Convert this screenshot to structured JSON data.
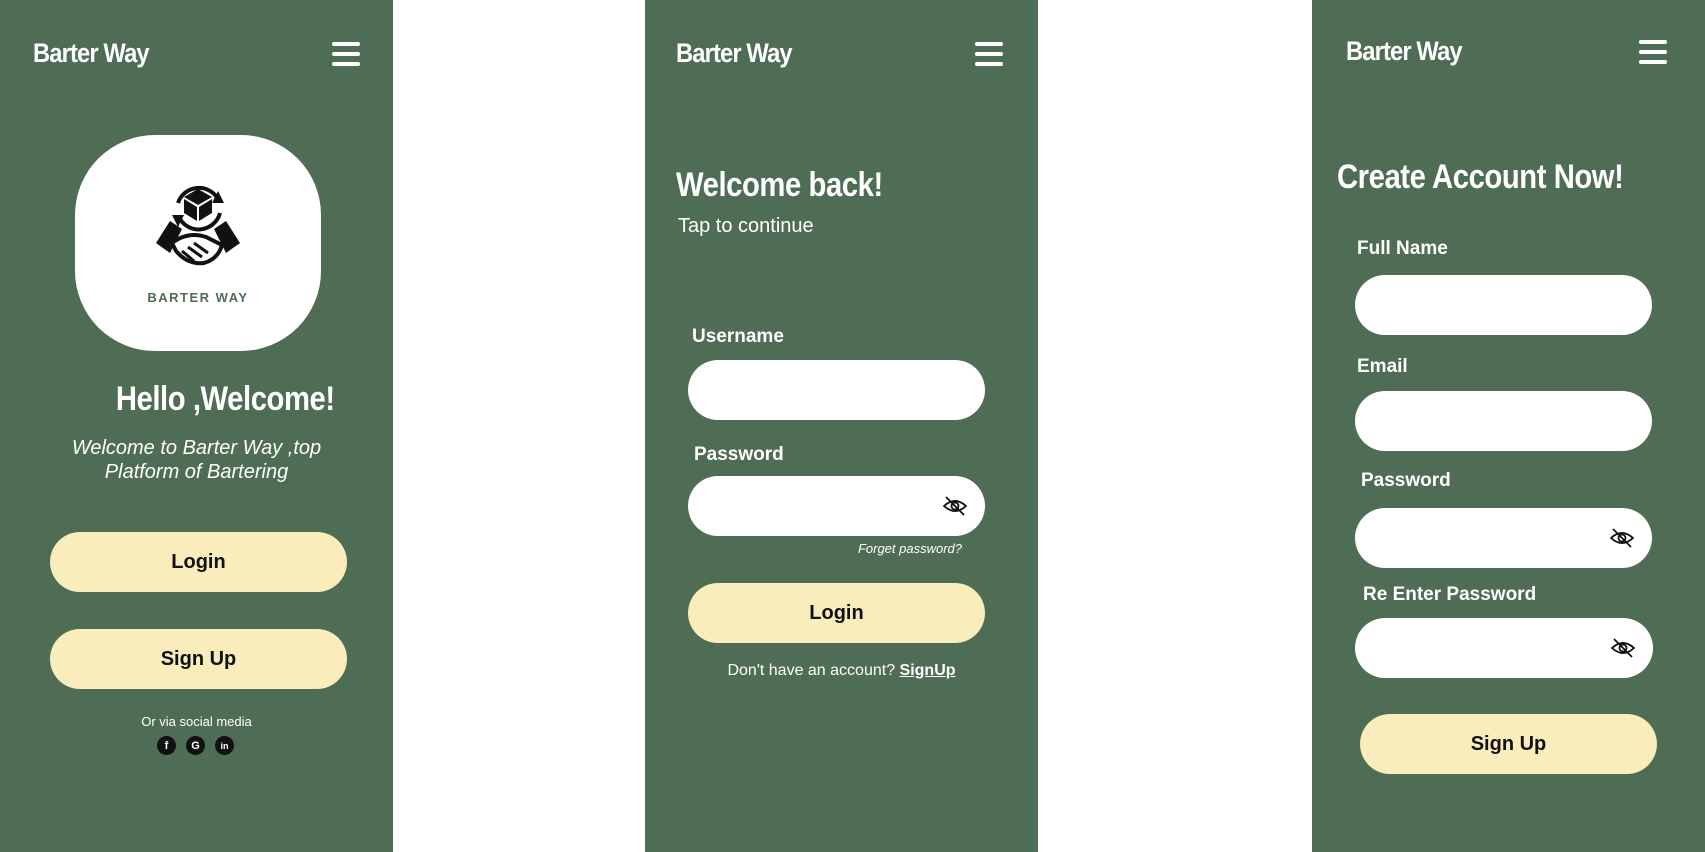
{
  "brand": {
    "name": "Barter Way"
  },
  "welcome": {
    "logo_text": "BARTER WAY",
    "heading": "Hello ,Welcome!",
    "subtitle_line1": "Welcome to Barter Way ,top",
    "subtitle_line2": "Platform of Bartering",
    "login_label": "Login",
    "signup_label": "Sign Up",
    "social_text": "Or via social media",
    "social_icons": [
      "facebook-icon",
      "google-icon",
      "linkedin-icon"
    ]
  },
  "login": {
    "heading": "Welcome back!",
    "subtitle": "Tap to continue",
    "username_label": "Username",
    "username_value": "",
    "password_label": "Password",
    "password_value": "",
    "forgot_label": "Forget password?",
    "login_label": "Login",
    "no_account_text": "Don't have an account? ",
    "signup_link": "SignUp"
  },
  "signup": {
    "heading": "Create Account Now!",
    "fullname_label": "Full Name",
    "fullname_value": "",
    "email_label": "Email",
    "email_value": "",
    "password_label": "Password",
    "password_value": "",
    "reenter_label": "Re Enter Password",
    "reenter_value": "",
    "signup_label": "Sign Up"
  },
  "colors": {
    "panel": "#4f6d55",
    "button": "#f8edbb",
    "field": "#ffffff"
  }
}
